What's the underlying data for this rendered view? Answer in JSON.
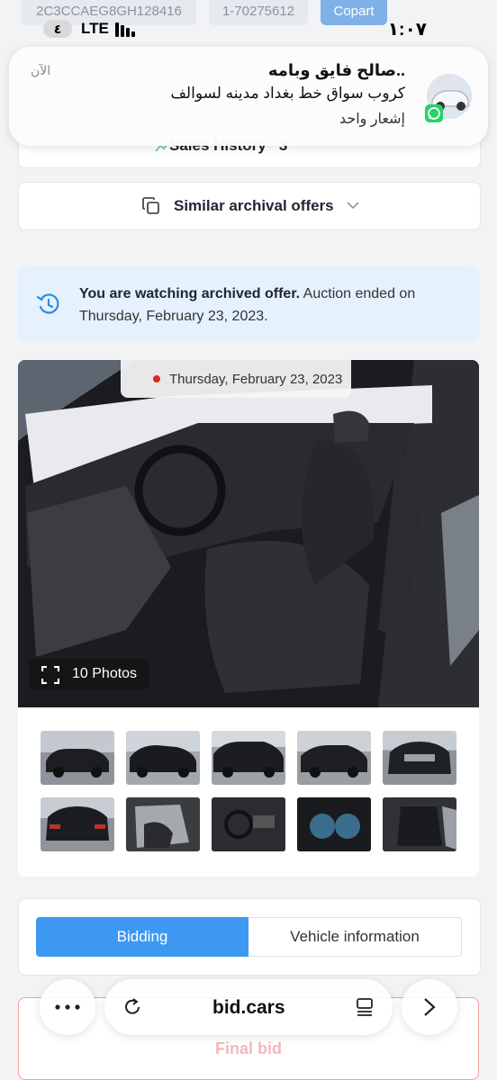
{
  "top_chips": {
    "vin": "2C3CCAEG8GH128416",
    "lot": "1-70275612",
    "source": "Copart"
  },
  "status_bar": {
    "battery": "٤",
    "network": "LTE",
    "time": "١:٠٧"
  },
  "notification": {
    "time": "الآن",
    "sender": "..صالح فايق وبامه",
    "message": "كروب سواق خط بغداد مدينه لسوالف",
    "count": "إشعار واحد",
    "app_icon": "whatsapp-icon"
  },
  "sales_history": {
    "label": "Sales History",
    "count": "3"
  },
  "similar_offers": {
    "label": "Similar archival offers"
  },
  "archived_alert": {
    "bold": "You are watching archived offer.",
    "text": " Auction ended on Thursday, February 23, 2023."
  },
  "gallery": {
    "date": "Thursday, February 23, 2023",
    "photos_label": "10 Photos"
  },
  "tabs": {
    "bidding": "Bidding",
    "vehicle_info": "Vehicle information"
  },
  "final_bid": {
    "label": "Final bid"
  },
  "browser": {
    "url": "bid.cars"
  },
  "colors": {
    "accent": "#3d98f2",
    "alert_bg": "#e5f1fc",
    "final_bid_border": "#f0a0a0"
  }
}
